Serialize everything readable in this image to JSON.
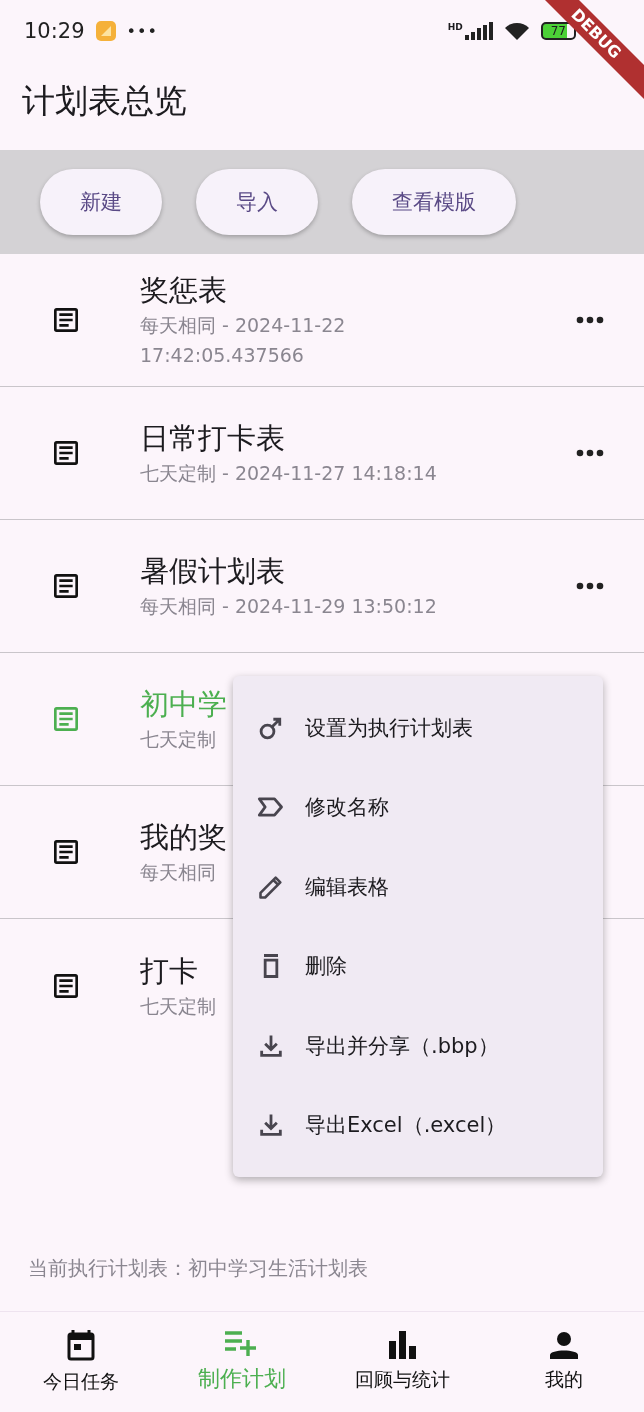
{
  "status_bar": {
    "time": "10:29",
    "dots": "•••",
    "network": "HD",
    "battery": "77"
  },
  "debug_banner": "DEBUG",
  "title": "计划表总览",
  "toolbar": {
    "buttons": [
      "新建",
      "导入",
      "查看模版"
    ]
  },
  "plans": [
    {
      "name": "奖惩表",
      "subtitle": "每天相同 -  2024-11-22 17:42:05.437566",
      "selected": false,
      "more": true
    },
    {
      "name": "日常打卡表",
      "subtitle": "七天定制 -  2024-11-27 14:18:14",
      "selected": false,
      "more": true
    },
    {
      "name": "暑假计划表",
      "subtitle": "每天相同 -  2024-11-29 13:50:12",
      "selected": false,
      "more": true
    },
    {
      "name": "初中学",
      "subtitle": "七天定制",
      "selected": true,
      "more": false
    },
    {
      "name": "我的奖",
      "subtitle": "每天相同",
      "selected": false,
      "more": false
    },
    {
      "name": "打卡",
      "subtitle": "七天定制",
      "selected": false,
      "more": false
    }
  ],
  "context_menu": {
    "items": [
      "设置为执行计划表",
      "修改名称",
      "编辑表格",
      "删除",
      "导出并分享（.bbp）",
      "导出Excel（.excel）"
    ]
  },
  "current_plan": "当前执行计划表：初中学习生活计划表",
  "bottom_nav": [
    {
      "label": "今日任务",
      "selected": false
    },
    {
      "label": "制作计划",
      "selected": true
    },
    {
      "label": "回顾与统计",
      "selected": false
    },
    {
      "label": "我的",
      "selected": false
    }
  ]
}
